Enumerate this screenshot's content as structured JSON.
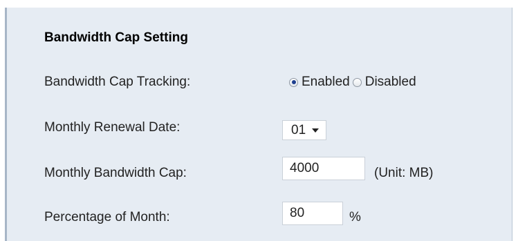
{
  "section": {
    "title": "Bandwidth Cap Setting"
  },
  "tracking": {
    "label": "Bandwidth Cap Tracking:",
    "options": [
      {
        "label": "Enabled",
        "selected": true
      },
      {
        "label": "Disabled",
        "selected": false
      }
    ]
  },
  "renewal": {
    "label": "Monthly Renewal Date:",
    "value": "01"
  },
  "cap": {
    "label": "Monthly Bandwidth Cap:",
    "value": "4000",
    "unit": "(Unit: MB)"
  },
  "percentage": {
    "label": "Percentage of Month:",
    "value": "80",
    "unit": "%"
  },
  "icons": {
    "dropdown": "chevron-down-icon",
    "radio_on": "radio-selected-icon",
    "radio_off": "radio-unselected-icon"
  },
  "colors": {
    "panel_bg": "#e6ecf3",
    "panel_border": "#a7b6c7",
    "radio_dot": "#1e3f8f"
  }
}
